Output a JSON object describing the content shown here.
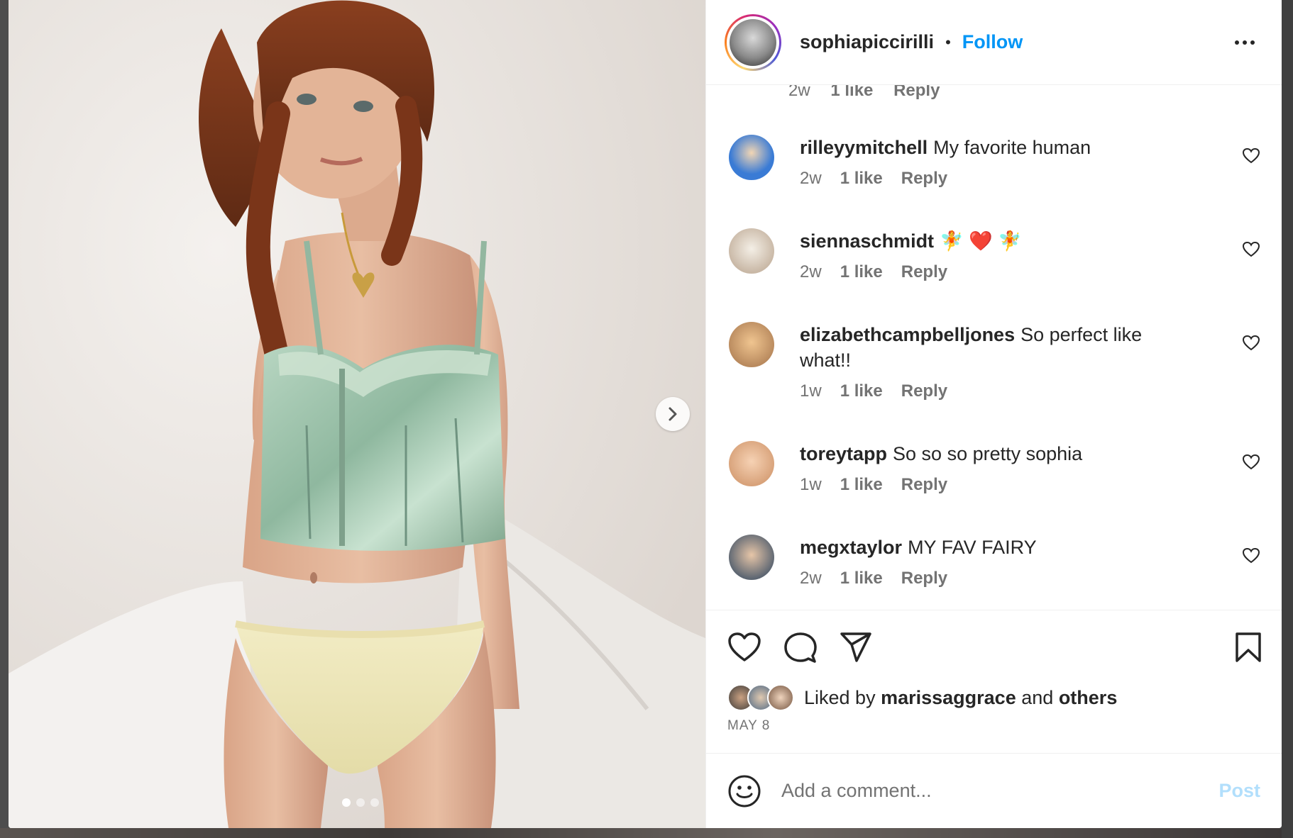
{
  "post": {
    "owner": "sophiapiccirilli",
    "separator": "•",
    "follow_label": "Follow",
    "carousel": {
      "count": 3,
      "active_index": 0
    }
  },
  "partial_comment": {
    "time": "2w",
    "likes": "1 like",
    "reply": "Reply"
  },
  "comments": [
    {
      "user": "rilleyymitchell",
      "text": "My favorite human",
      "time": "2w",
      "likes": "1 like",
      "reply": "Reply",
      "avatar_color": "#3a7bd5"
    },
    {
      "user": "siennaschmidt",
      "text": "🧚 ❤️ 🧚",
      "time": "2w",
      "likes": "1 like",
      "reply": "Reply",
      "avatar_color": "#c9b8a6"
    },
    {
      "user": "elizabethcampbelljones",
      "text": "So perfect like what!!",
      "time": "1w",
      "likes": "1 like",
      "reply": "Reply",
      "avatar_color": "#b98a5e"
    },
    {
      "user": "toreytapp",
      "text": "So so so pretty sophia",
      "time": "1w",
      "likes": "1 like",
      "reply": "Reply",
      "avatar_color": "#d8a27a"
    },
    {
      "user": "megxtaylor",
      "text": "MY FAV FAIRY",
      "time": "2w",
      "likes": "1 like",
      "reply": "Reply",
      "avatar_color": "#5d6672"
    }
  ],
  "likes": {
    "prefix": "Liked by",
    "user": "marissaggrace",
    "joiner": "and",
    "others": "others"
  },
  "date": "MAY 8",
  "composer": {
    "placeholder": "Add a comment...",
    "post_label": "Post"
  },
  "colors": {
    "link": "#0095f6",
    "post_disabled": "#b2dffc",
    "text": "#262626",
    "muted": "#737373"
  },
  "icons": [
    "next-arrow-icon",
    "more-options-icon",
    "heart-icon",
    "comment-icon",
    "share-icon",
    "bookmark-icon",
    "emoji-icon"
  ]
}
